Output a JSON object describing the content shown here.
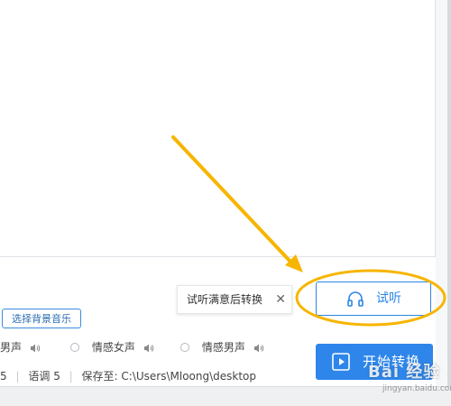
{
  "toolbar": {
    "bgm_button_label": "选择背景音乐"
  },
  "tooltip": {
    "text": "试听满意后转换",
    "close_glyph": "✕"
  },
  "preview": {
    "label": "试听"
  },
  "voices": [
    {
      "label": "男声"
    },
    {
      "label": "情感女声"
    },
    {
      "label": "情感男声"
    }
  ],
  "status": {
    "speed": "5",
    "tone_label": "语调",
    "tone": "5",
    "save_label": "保存至:",
    "save_path": "C:\\Users\\Mloong\\desktop"
  },
  "start": {
    "label": "开始转换"
  },
  "watermark": {
    "text": "Bai 经验",
    "sub": "jingyan.baidu.com"
  },
  "colors": {
    "accent": "#2e86ea",
    "annotation": "#f7b500"
  }
}
